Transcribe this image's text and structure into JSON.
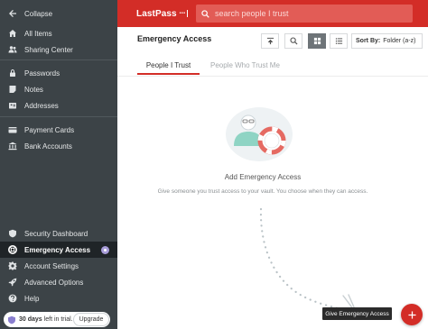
{
  "app": {
    "logo_text": "LastPass",
    "logo_dots": "•••"
  },
  "search": {
    "placeholder": "search people I trust"
  },
  "sidebar": {
    "collapse": "Collapse",
    "items": [
      {
        "label": "All Items",
        "icon": "home-icon"
      },
      {
        "label": "Sharing Center",
        "icon": "people-icon"
      },
      {
        "label": "Passwords",
        "icon": "lock-icon"
      },
      {
        "label": "Notes",
        "icon": "note-icon"
      },
      {
        "label": "Addresses",
        "icon": "address-card-icon"
      },
      {
        "label": "Payment Cards",
        "icon": "credit-card-icon"
      },
      {
        "label": "Bank Accounts",
        "icon": "bank-icon"
      },
      {
        "label": "Security Dashboard",
        "icon": "shield-icon"
      },
      {
        "label": "Emergency Access",
        "icon": "lifebuoy-icon",
        "active": true
      },
      {
        "label": "Account Settings",
        "icon": "gear-icon"
      },
      {
        "label": "Advanced Options",
        "icon": "rocket-icon"
      },
      {
        "label": "Help",
        "icon": "help-icon"
      }
    ],
    "trial": {
      "days": "30 days",
      "suffix": "left in trial.",
      "upgrade_label": "Upgrade"
    }
  },
  "main": {
    "title": "Emergency Access",
    "sort_label": "Sort By:",
    "sort_value": "Folder (a-z)",
    "tabs": [
      {
        "label": "People I Trust",
        "active": true
      },
      {
        "label": "People Who Trust Me",
        "active": false
      }
    ],
    "empty_title": "Add Emergency Access",
    "empty_desc": "Give someone you trust access to your vault. You choose when they can access.",
    "tooltip": "Give Emergency Access"
  },
  "colors": {
    "brand": "#d32d27",
    "sidebar_bg": "#3c4347",
    "sidebar_active": "#1f2427"
  }
}
